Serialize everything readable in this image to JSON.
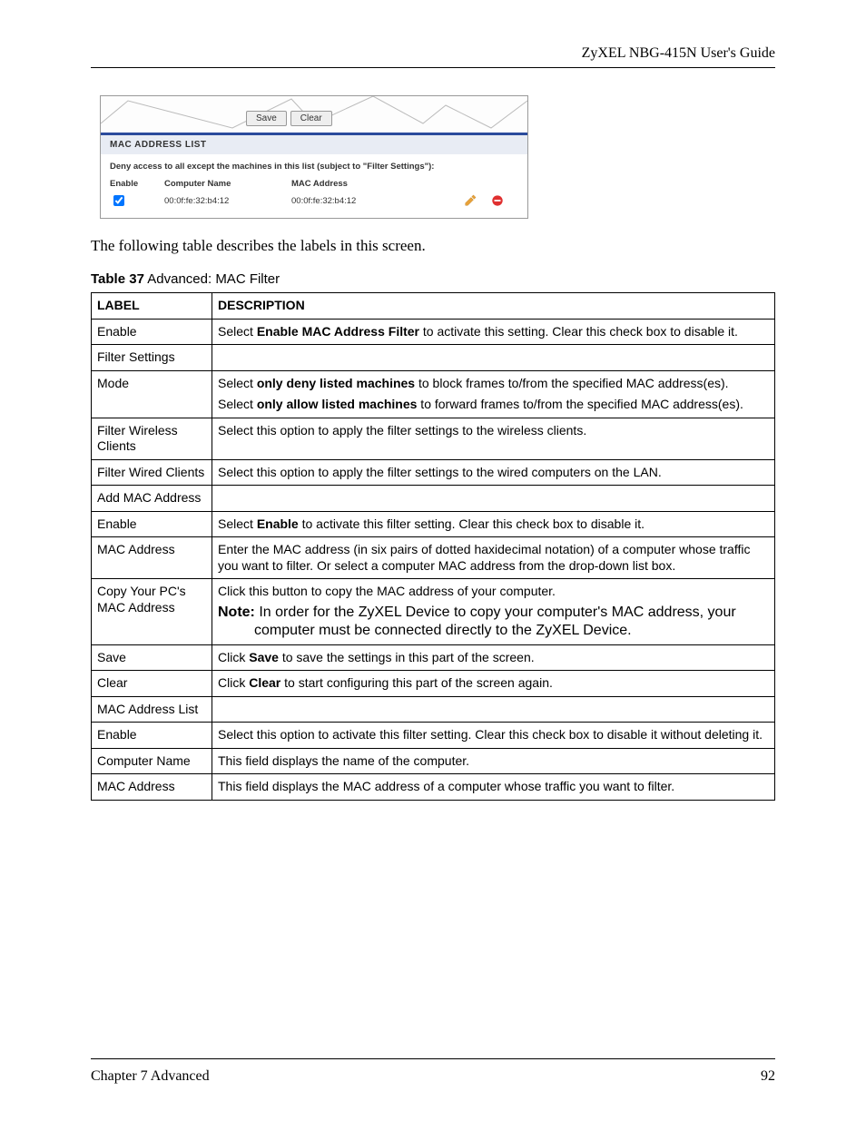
{
  "header": {
    "title": "ZyXEL NBG-415N User's Guide"
  },
  "screenshot": {
    "buttons": {
      "save": "Save",
      "clear": "Clear"
    },
    "list_title": "MAC ADDRESS LIST",
    "note": "Deny access to all except the machines in this list (subject to \"Filter Settings\"):",
    "columns": {
      "enable": "Enable",
      "name": "Computer Name",
      "mac": "MAC Address"
    },
    "row": {
      "name": "00:0f:fe:32:b4:12",
      "mac": "00:0f:fe:32:b4:12"
    }
  },
  "lead": "The following table describes the labels in this screen.",
  "caption": {
    "bold": "Table 37",
    "rest": "   Advanced: MAC Filter"
  },
  "table": {
    "head": {
      "label": "LABEL",
      "desc": "DESCRIPTION"
    },
    "rows": [
      {
        "label": "Enable",
        "desc_pre": "Select ",
        "desc_b1": "Enable MAC Address Filter",
        "desc_post": " to activate this setting. Clear this check box to disable it."
      },
      {
        "label": "Filter Settings",
        "desc_plain": ""
      },
      {
        "label": "Mode",
        "mode_pre1": "Select ",
        "mode_b1": "only deny listed machines",
        "mode_post1": " to block frames to/from the specified MAC address(es).",
        "mode_pre2": "Select ",
        "mode_b2": "only allow listed machines",
        "mode_post2": " to forward frames to/from the specified MAC address(es)."
      },
      {
        "label": "Filter Wireless Clients",
        "desc_plain": "Select this option to apply the filter settings to the wireless clients."
      },
      {
        "label": "Filter Wired Clients",
        "desc_plain": "Select this option to apply the filter settings to the wired computers on the LAN."
      },
      {
        "label": "Add MAC Address",
        "desc_plain": ""
      },
      {
        "label": "Enable",
        "desc_pre": "Select ",
        "desc_b1": "Enable",
        "desc_post": " to activate this filter setting. Clear this check box to disable it."
      },
      {
        "label": "MAC Address",
        "desc_plain": "Enter the MAC address (in six pairs of dotted haxidecimal notation) of a computer whose traffic you want to filter. Or select a computer MAC address from the drop-down list box."
      },
      {
        "label": "Copy Your PC's MAC Address",
        "copy_line": "Click this button to copy the MAC address of your computer.",
        "note_b": "Note:",
        "note_rest": " In order for the ZyXEL Device to copy your computer's MAC address, your computer must be connected directly to the ZyXEL Device."
      },
      {
        "label": "Save",
        "desc_pre": "Click ",
        "desc_b1": "Save",
        "desc_post": " to save the settings in this part of the screen."
      },
      {
        "label": "Clear",
        "desc_pre": "Click ",
        "desc_b1": "Clear",
        "desc_post": " to start configuring this part of the screen again."
      },
      {
        "label": "MAC Address List",
        "desc_plain": ""
      },
      {
        "label": "Enable",
        "desc_plain": "Select this option to activate this filter setting. Clear this check box to disable it without deleting it."
      },
      {
        "label": "Computer Name",
        "desc_plain": "This field displays the name of the computer."
      },
      {
        "label": "MAC Address",
        "desc_plain": "This field displays the MAC address of a computer whose traffic you want to filter."
      }
    ]
  },
  "footer": {
    "left": "Chapter 7 Advanced",
    "right": "92"
  }
}
